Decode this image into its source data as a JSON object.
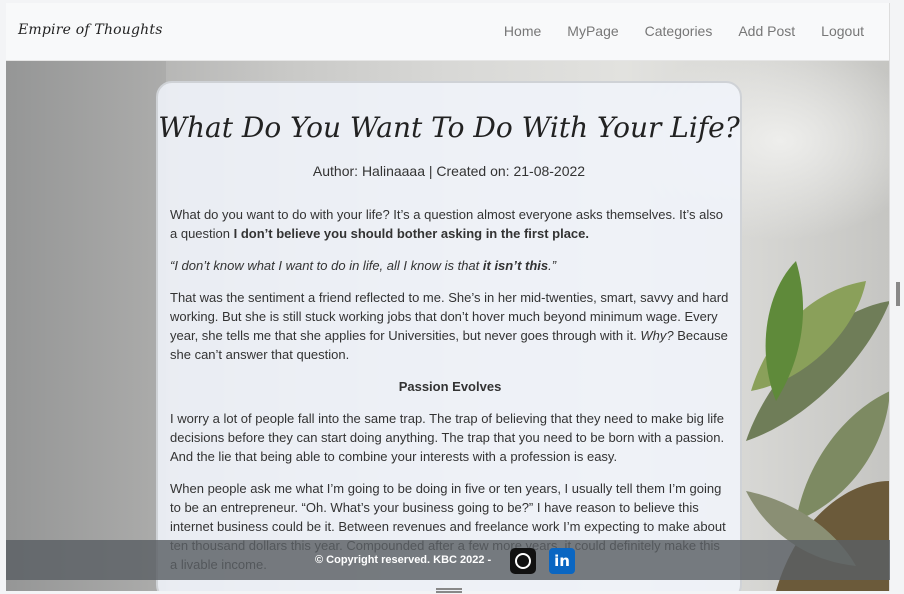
{
  "nav": {
    "brand": "Empire of Thoughts",
    "links": [
      "Home",
      "MyPage",
      "Categories",
      "Add Post",
      "Logout"
    ]
  },
  "post": {
    "title": "What Do You Want To Do With Your Life?",
    "meta": "Author: Halinaaaa | Created on: 21-08-2022",
    "p1_a": "What do you want to do with your life? It’s a question almost everyone asks themselves. It’s also a question ",
    "p1_b": "I don’t believe you should bother asking in the first place.",
    "quote_a": "“I don’t know what I want to do in life, all I know is that ",
    "quote_b": "it isn’t this",
    "quote_c": ".”",
    "p2_a": "That was the sentiment a friend reflected to me. She’s in her mid-twenties, smart, savvy and hard working. But she is still stuck working jobs that don’t hover much beyond minimum wage. Every year, she tells me that she applies for Universities, but never goes through with it. ",
    "p2_b": "Why?",
    "p2_c": " Because she can’t answer that question.",
    "subhead": "Passion Evolves",
    "p3": "I worry a lot of people fall into the same trap. The trap of believing that they need to make big life decisions before they can start doing anything. The trap that you need to be born with a passion. And the lie that being able to combine your interests with a profession is easy.",
    "p4": "When people ask me what I’m going to be doing in five or ten years, I usually tell them I’m going to be an entrepreneur. “Oh. What’s your business going to be?” I have reason to believe this internet business could be it. Between revenues and freelance work I’m expecting to make about ten thousand dollars this year. Compounded after a few more years, it could definitely make this a livable income."
  },
  "footer": {
    "copyright": "© Copyright reserved. KBC 2022 -",
    "linkedin_glyph": "in"
  },
  "colors": {
    "footer_bg": "#5a5f64",
    "linkedin": "#0a66c2"
  }
}
